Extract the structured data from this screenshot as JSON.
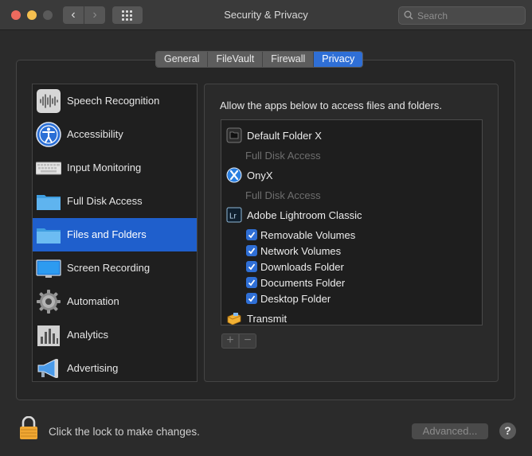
{
  "window": {
    "title": "Security & Privacy"
  },
  "search": {
    "placeholder": "Search"
  },
  "tabs": [
    {
      "label": "General",
      "active": false
    },
    {
      "label": "FileVault",
      "active": false
    },
    {
      "label": "Firewall",
      "active": false
    },
    {
      "label": "Privacy",
      "active": true
    }
  ],
  "sidebar": {
    "items": [
      {
        "label": "Speech Recognition",
        "icon": "speech-waveform-icon"
      },
      {
        "label": "Accessibility",
        "icon": "accessibility-icon"
      },
      {
        "label": "Input Monitoring",
        "icon": "keyboard-icon"
      },
      {
        "label": "Full Disk Access",
        "icon": "folder-icon"
      },
      {
        "label": "Files and Folders",
        "icon": "folder-icon",
        "selected": true
      },
      {
        "label": "Screen Recording",
        "icon": "display-icon"
      },
      {
        "label": "Automation",
        "icon": "gear-icon"
      },
      {
        "label": "Analytics",
        "icon": "bar-chart-icon"
      },
      {
        "label": "Advertising",
        "icon": "megaphone-icon"
      }
    ]
  },
  "main": {
    "description": "Allow the apps below to access files and folders.",
    "apps": [
      {
        "name": "Default Folder X",
        "icon": "default-folder-x-icon",
        "note": "Full Disk Access"
      },
      {
        "name": "OnyX",
        "icon": "onyx-icon",
        "note": "Full Disk Access"
      },
      {
        "name": "Adobe Lightroom Classic",
        "icon": "lightroom-icon",
        "permissions": [
          {
            "label": "Removable Volumes",
            "checked": true
          },
          {
            "label": "Network Volumes",
            "checked": true
          },
          {
            "label": "Downloads Folder",
            "checked": true
          },
          {
            "label": "Documents Folder",
            "checked": true
          },
          {
            "label": "Desktop Folder",
            "checked": true
          }
        ]
      },
      {
        "name": "Transmit",
        "icon": "transmit-truck-icon"
      }
    ],
    "add_label": "+",
    "remove_label": "−"
  },
  "footer": {
    "lock_text": "Click the lock to make changes.",
    "advanced_label": "Advanced...",
    "help_label": "?"
  },
  "colors": {
    "accent": "#2f6fd6",
    "selection": "#1f5fcc",
    "window_bg": "#2b2b2b"
  }
}
